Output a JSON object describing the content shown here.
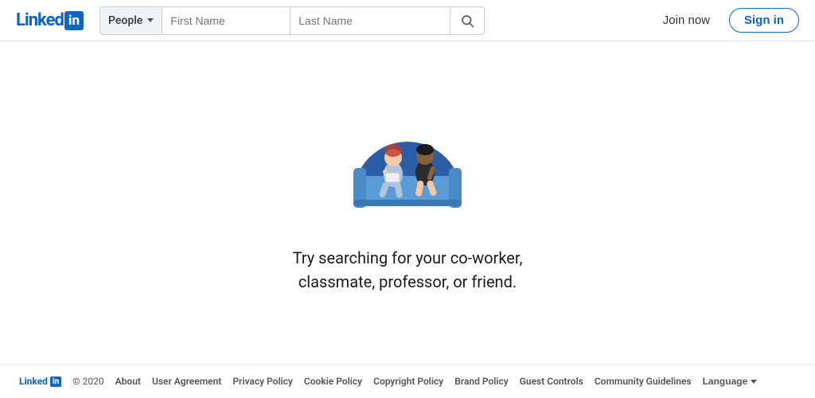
{
  "header": {
    "logo_text": "Linked",
    "logo_in": "in",
    "search_category": "People",
    "first_name_placeholder": "First Name",
    "last_name_placeholder": "Last Name",
    "join_now_label": "Join now",
    "sign_in_label": "Sign in"
  },
  "main": {
    "empty_state_line1": "Try searching for your co-worker,",
    "empty_state_line2": "classmate, professor, or friend."
  },
  "footer": {
    "logo_text": "Linked",
    "logo_in": "in",
    "copyright": "© 2020",
    "links": [
      {
        "label": "About"
      },
      {
        "label": "User Agreement"
      },
      {
        "label": "Privacy Policy"
      },
      {
        "label": "Cookie Policy"
      },
      {
        "label": "Copyright Policy"
      },
      {
        "label": "Brand Policy"
      },
      {
        "label": "Guest Controls"
      },
      {
        "label": "Community Guidelines"
      },
      {
        "label": "Language"
      }
    ]
  }
}
